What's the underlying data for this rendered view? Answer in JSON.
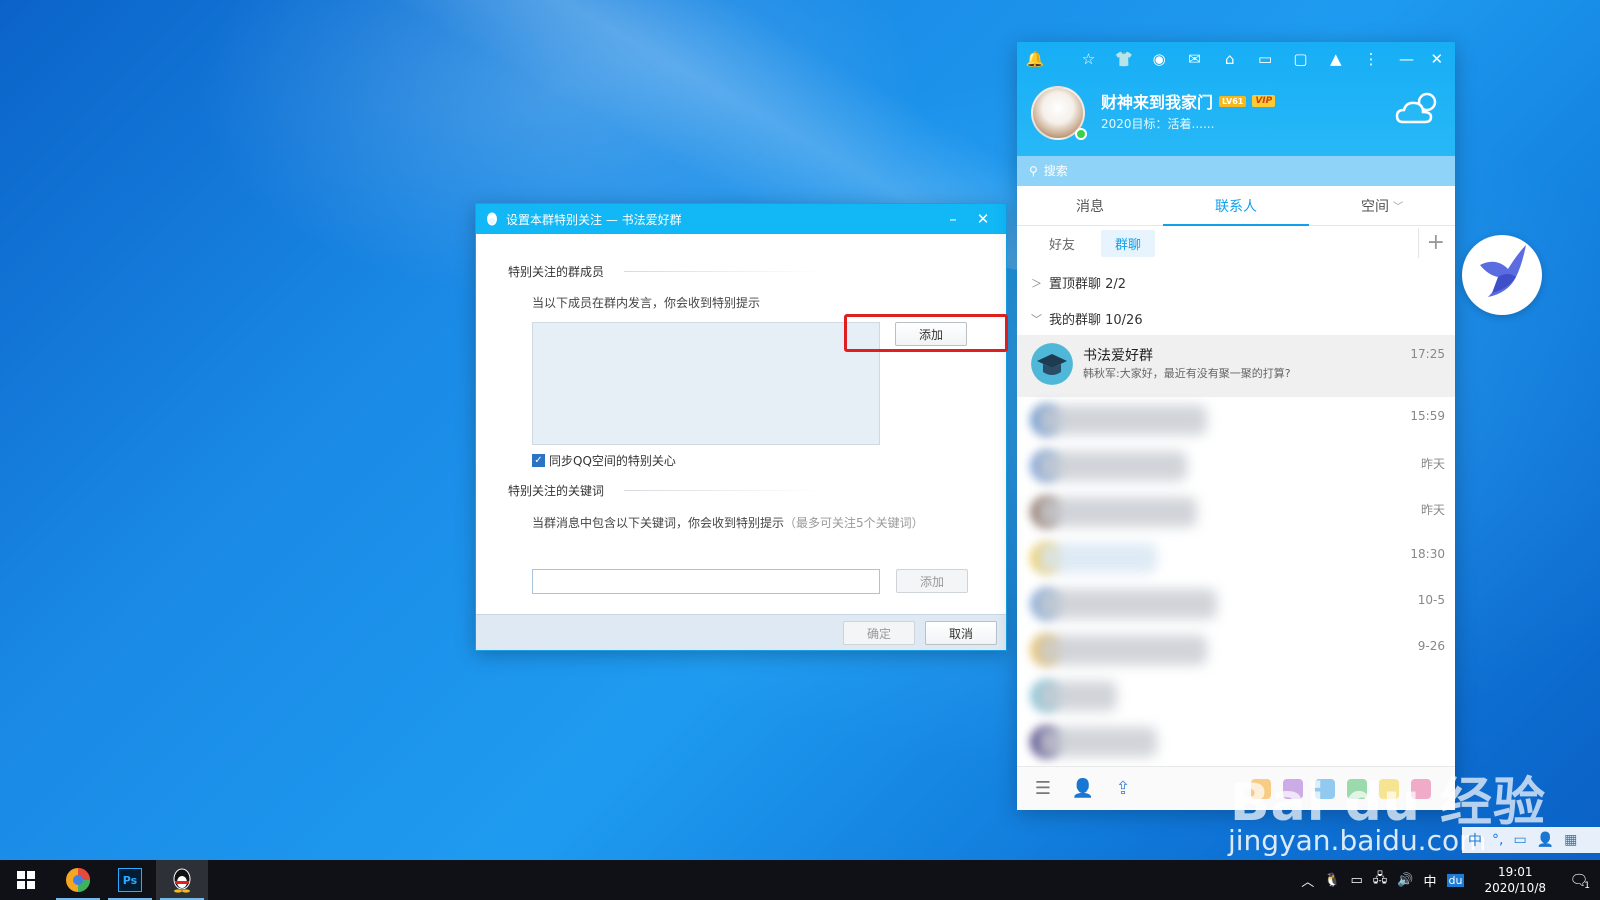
{
  "dialog": {
    "title": "设置本群特别关注 — 书法爱好群",
    "minimize": "–",
    "close": "✕",
    "section_members": "特别关注的群成员",
    "members_hint": "当以下成员在群内发言，你会收到特别提示",
    "add_member_label": "添加",
    "sync_checkbox_label": "同步QQ空间的特别关心",
    "sync_checked": true,
    "section_keywords": "特别关注的关键词",
    "keywords_hint": "当群消息中包含以下关键词，你会收到特别提示",
    "keywords_hint_note": "（最多可关注5个关键词）",
    "keyword_input_value": "",
    "add_keyword_label": "添加",
    "ok_label": "确定",
    "cancel_label": "取消"
  },
  "qq": {
    "nickname": "财神来到我家门",
    "level_badge": "LV61",
    "vip_badge": "VIP",
    "signature": "2020目标：活着......",
    "search_placeholder": "搜索",
    "tabs": [
      "消息",
      "联系人",
      "空间"
    ],
    "active_tab": 1,
    "sub_tabs": [
      "好友",
      "群聊"
    ],
    "active_sub_tab": 1,
    "add_symbol": "+",
    "group_pinned": "置顶群聊 2/2",
    "group_mine": "我的群聊 10/26",
    "contacts": [
      {
        "name": "书法爱好群",
        "message": "韩秋军:大家好，最近有没有聚一聚的打算?",
        "time": "17:25",
        "selected": true
      },
      {
        "name": "",
        "message": "",
        "time": "15:59"
      },
      {
        "name": "",
        "message": "",
        "time": "昨天"
      },
      {
        "name": "",
        "message": "",
        "time": "昨天"
      },
      {
        "name": "",
        "message": "",
        "time": "18:30"
      },
      {
        "name": "",
        "message": "",
        "time": "10-5"
      },
      {
        "name": "",
        "message": "",
        "time": "9-26"
      },
      {
        "name": "",
        "message": "",
        "time": ""
      },
      {
        "name": "",
        "message": "",
        "time": ""
      }
    ]
  },
  "watermark": {
    "logo": "Bai du 经验",
    "url": "jingyan.baidu.com"
  },
  "taskbar": {
    "time": "19:01",
    "date": "2020/10/8",
    "ime": "中",
    "notification_count": "1"
  },
  "colors": {
    "qq_blue": "#12b7f5",
    "highlight_red": "#e02020",
    "active_tab": "#12a0ec"
  }
}
